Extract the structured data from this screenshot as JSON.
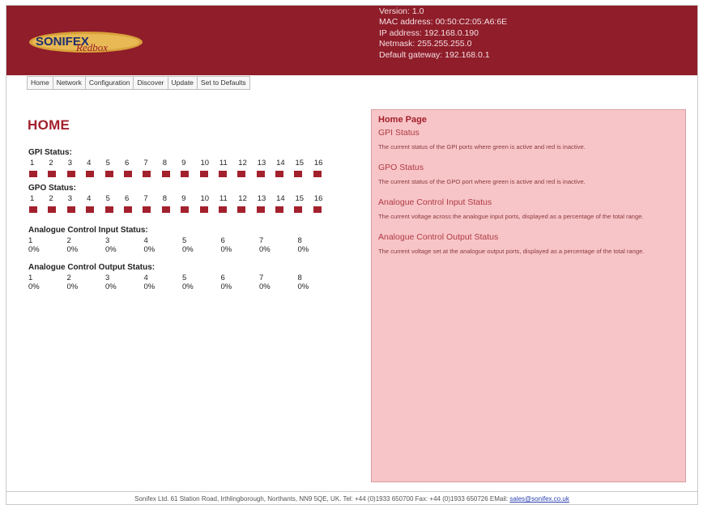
{
  "header": {
    "logo": {
      "text_main": "SONIFEX",
      "text_sub": "Redbox"
    },
    "device_info": {
      "version": "Version: 1.0",
      "mac": "MAC address: 00:50:C2:05:A6:6E",
      "ip": "IP address: 192.168.0.190",
      "netmask": "Netmask: 255.255.255.0",
      "gateway": "Default gateway: 192.168.0.1"
    }
  },
  "nav": {
    "items": [
      {
        "label": "Home"
      },
      {
        "label": "Network"
      },
      {
        "label": "Configuration"
      },
      {
        "label": "Discover"
      },
      {
        "label": "Update"
      },
      {
        "label": "Set to Defaults"
      }
    ]
  },
  "main": {
    "title": "HOME",
    "gpi": {
      "label": "GPI Status:",
      "ports": [
        "1",
        "2",
        "3",
        "4",
        "5",
        "6",
        "7",
        "8",
        "9",
        "10",
        "11",
        "12",
        "13",
        "14",
        "15",
        "16"
      ],
      "state_color": "#a3202d"
    },
    "gpo": {
      "label": "GPO Status:",
      "ports": [
        "1",
        "2",
        "3",
        "4",
        "5",
        "6",
        "7",
        "8",
        "9",
        "10",
        "11",
        "12",
        "13",
        "14",
        "15",
        "16"
      ],
      "state_color": "#a3202d"
    },
    "analog_in": {
      "label": "Analogue Control Input Status:",
      "channels": [
        "1",
        "2",
        "3",
        "4",
        "5",
        "6",
        "7",
        "8"
      ],
      "values": [
        "0%",
        "0%",
        "0%",
        "0%",
        "0%",
        "0%",
        "0%",
        "0%"
      ]
    },
    "analog_out": {
      "label": "Analogue Control Output Status:",
      "channels": [
        "1",
        "2",
        "3",
        "4",
        "5",
        "6",
        "7",
        "8"
      ],
      "values": [
        "0%",
        "0%",
        "0%",
        "0%",
        "0%",
        "0%",
        "0%",
        "0%"
      ]
    }
  },
  "help": {
    "title": "Home Page",
    "gpi_heading": "GPI Status",
    "gpi_text": "The current status of the GPI ports where green is active and red is inactive.",
    "gpo_heading": "GPO Status",
    "gpo_text": "The current status of the GPO port where green is active and red is inactive.",
    "ain_heading": "Analogue Control Input Status",
    "ain_text": "The current voltage across the analogue input ports, displayed as a percentage of the total range.",
    "aout_heading": "Analogue Control Output Status",
    "aout_text": "The current voltage set at the analogue output ports, displayed as a percentage of the total range."
  },
  "footer": {
    "address": "Sonifex Ltd. 61 Station Road, Irthlingborough, Northants, NN9 5QE, UK. Tel: +44 (0)1933 650700 Fax: +44 (0)1933 650726 EMail: ",
    "email": "sales@sonifex.co.uk"
  },
  "colors": {
    "header_bg": "#8f1d2a",
    "accent": "#a3202d",
    "help_bg": "#f7c5c7",
    "inactive_port": "#a3202d"
  }
}
